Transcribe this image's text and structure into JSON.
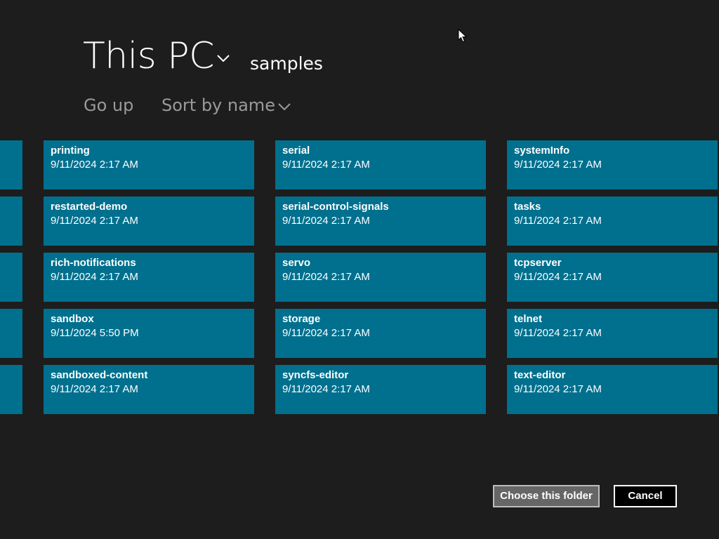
{
  "header": {
    "location": "This PC",
    "subfolder": "samples"
  },
  "toolbar": {
    "go_up_label": "Go up",
    "sort_label": "Sort by name"
  },
  "tiles": [
    {
      "name": "printing",
      "date": "9/11/2024 2:17 AM"
    },
    {
      "name": "restarted-demo",
      "date": "9/11/2024 2:17 AM"
    },
    {
      "name": "rich-notifications",
      "date": "9/11/2024 2:17 AM"
    },
    {
      "name": "sandbox",
      "date": "9/11/2024 5:50 PM"
    },
    {
      "name": "sandboxed-content",
      "date": "9/11/2024 2:17 AM"
    },
    {
      "name": "serial",
      "date": "9/11/2024 2:17 AM"
    },
    {
      "name": "serial-control-signals",
      "date": "9/11/2024 2:17 AM"
    },
    {
      "name": "servo",
      "date": "9/11/2024 2:17 AM"
    },
    {
      "name": "storage",
      "date": "9/11/2024 2:17 AM"
    },
    {
      "name": "syncfs-editor",
      "date": "9/11/2024 2:17 AM"
    },
    {
      "name": "systemInfo",
      "date": "9/11/2024 2:17 AM"
    },
    {
      "name": "tasks",
      "date": "9/11/2024 2:17 AM"
    },
    {
      "name": "tcpserver",
      "date": "9/11/2024 2:17 AM"
    },
    {
      "name": "telnet",
      "date": "9/11/2024 2:17 AM"
    },
    {
      "name": "text-editor",
      "date": "9/11/2024 2:17 AM"
    }
  ],
  "buttons": {
    "choose_label": "Choose this folder",
    "cancel_label": "Cancel"
  },
  "icons": {
    "location_dropdown": "chevron-down-icon",
    "sort_dropdown": "chevron-down-icon",
    "cursor": "mouse-pointer-icon"
  },
  "colors": {
    "background": "#1d1d1d",
    "tile": "#00708e",
    "secondary_text": "#9a9a9a"
  }
}
